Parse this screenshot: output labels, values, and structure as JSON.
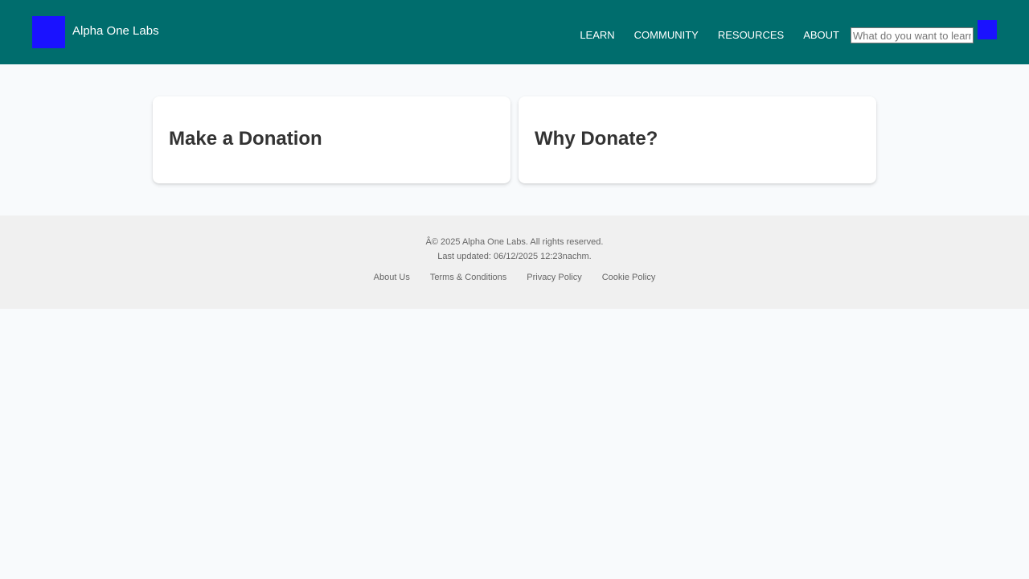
{
  "brand": {
    "name": "Alpha One Labs",
    "logo_color": "#1a12ff"
  },
  "nav": {
    "items": [
      {
        "label": "LEARN"
      },
      {
        "label": "COMMUNITY"
      },
      {
        "label": "RESOURCES"
      },
      {
        "label": "ABOUT"
      }
    ],
    "search_placeholder": "What do you want to learn?",
    "search_icon": "search-icon"
  },
  "cards": [
    {
      "title": "Make a Donation"
    },
    {
      "title": "Why Donate?"
    }
  ],
  "footer": {
    "copyright": "Â© 2025 Alpha One Labs. All rights reserved.",
    "last_updated": "Last updated: 06/12/2025 12:23nachm.",
    "links": [
      {
        "label": "About Us"
      },
      {
        "label": "Terms & Conditions"
      },
      {
        "label": "Privacy Policy"
      },
      {
        "label": "Cookie Policy"
      }
    ]
  },
  "colors": {
    "header_bg": "#006d6d",
    "page_bg": "#f8fafc",
    "footer_bg": "#f0f0f0",
    "accent": "#1a12ff"
  }
}
